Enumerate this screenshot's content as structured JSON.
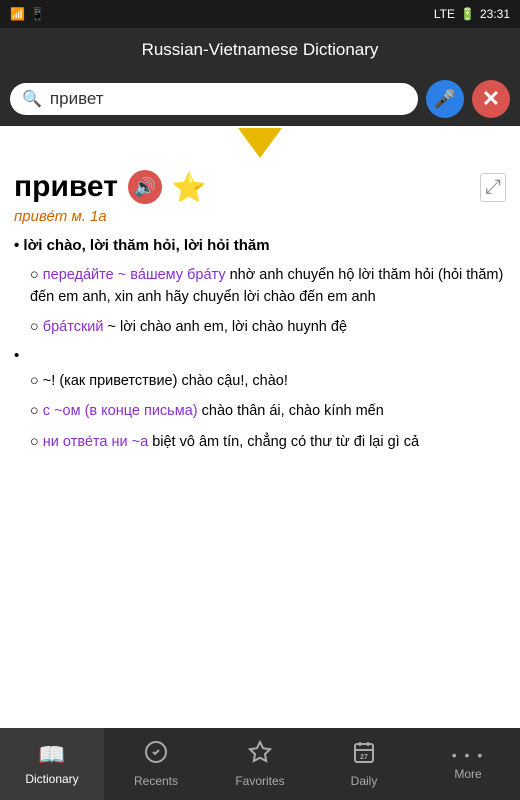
{
  "statusBar": {
    "leftIcons": "📶",
    "signal": "LTE",
    "time": "23:31",
    "battery": "🔋"
  },
  "titleBar": {
    "title": "Russian-Vietnamese  Dictionary"
  },
  "searchBar": {
    "query": "привет",
    "placeholder": "привет",
    "micLabel": "🎤",
    "closeLabel": "✕"
  },
  "entry": {
    "word": "привет",
    "subtitle": "приве́т м. 1а",
    "speakerLabel": "🔊",
    "starLabel": "★",
    "expandLabel": "⤢",
    "definitions": [
      {
        "type": "bullet",
        "text": "lời chào, lời thăm hỏi, lời hỏi thăm",
        "subItems": [
          {
            "prefix": "передáйте ~ вáшему брáту",
            "suffix": " nhờ anh chuyển hộ lời thăm hỏi (hỏi thăm) đến em anh, xin anh hãy chuyển lời chào đến em anh"
          },
          {
            "prefix": "брáтский",
            "suffix": " ~ lời chào anh em, lời chào huynh đệ"
          }
        ]
      },
      {
        "type": "empty-bullet",
        "text": "",
        "subItems": [
          {
            "prefix": "",
            "suffix": "~! (как приветствие) chào cậu!, chào!"
          },
          {
            "prefix": "с ~ом (в конце письма)",
            "suffix": " chào thân ái, chào kính mến"
          },
          {
            "prefix": "ни отве́та ни ~а",
            "suffix": " biệt vô âm tín, chẳng có thư từ đi lại gì cả"
          }
        ]
      }
    ]
  },
  "bottomNav": {
    "items": [
      {
        "id": "dictionary",
        "icon": "📖",
        "label": "Dictionary",
        "active": true
      },
      {
        "id": "recents",
        "icon": "✓",
        "label": "Recents",
        "active": false
      },
      {
        "id": "favorites",
        "icon": "☆",
        "label": "Favorites",
        "active": false
      },
      {
        "id": "daily",
        "icon": "📅",
        "label": "Daily",
        "active": false
      },
      {
        "id": "more",
        "icon": "···",
        "label": "More",
        "active": false
      }
    ]
  }
}
